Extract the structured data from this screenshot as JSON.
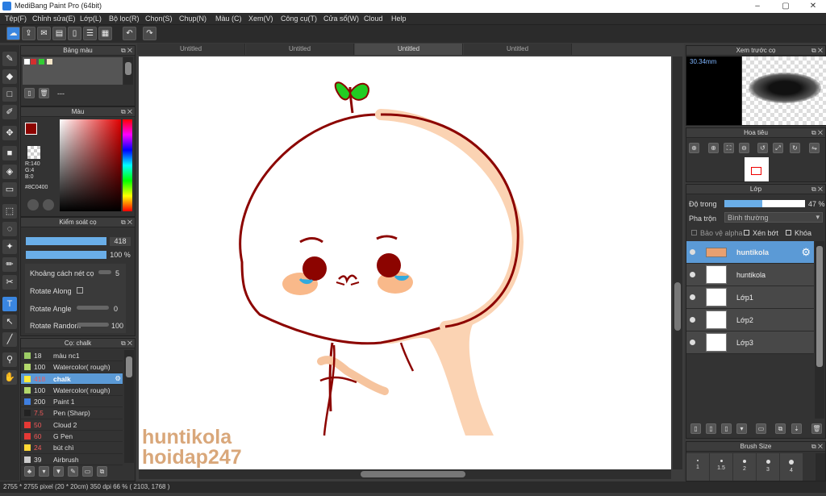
{
  "window": {
    "title": "MediBang Paint Pro (64bit)",
    "min": "–",
    "max": "▢",
    "close": "✕"
  },
  "menu": [
    "Tệp(F)",
    "Chỉnh sửa(E)",
    "Lớp(L)",
    "Bộ lọc(R)",
    "Chọn(S)",
    "Chụp(N)",
    "Màu (C)",
    "Xem(V)",
    "Công cụ(T)",
    "Cửa sổ(W)",
    "Cloud",
    "Help"
  ],
  "tabs": [
    "Untitled",
    "Untitled",
    "Untitled",
    "Untitled"
  ],
  "panels": {
    "palette": {
      "title": "Bảng màu",
      "list_value": "---"
    },
    "color": {
      "title": "Màu",
      "r": "R:140",
      "g": "G:4",
      "b": "B:0",
      "hex": "#8C0400",
      "fg": "#8c0400"
    },
    "brush_control": {
      "title": "Kiểm soát cọ",
      "size": "418",
      "opacity": "100 %",
      "spacing_label": "Khoảng cách nét cọ",
      "spacing_value": "5",
      "rotate_along": "Rotate Along",
      "rotate_angle": "Rotate Angle",
      "rotate_angle_value": "0",
      "rotate_random": "Rotate Random",
      "rotate_random_value": "100"
    },
    "brushes": {
      "title": "Cọ: chalk",
      "items": [
        {
          "n": "18",
          "l": "màu nc1",
          "c": "#9ccc65"
        },
        {
          "n": "100",
          "l": "Watercolor( rough)",
          "c": "#b2d86b"
        },
        {
          "n": "418",
          "l": "chalk",
          "c": "#ffeb3b"
        },
        {
          "n": "100",
          "l": "Watercolor( rough)",
          "c": "#b2d86b"
        },
        {
          "n": "200",
          "l": "Paint 1",
          "c": "#3f7fe0"
        },
        {
          "n": "7.5",
          "l": "Pen (Sharp)",
          "c": "#222222"
        },
        {
          "n": "50",
          "l": "Cloud 2",
          "c": "#e53935"
        },
        {
          "n": "60",
          "l": "G Pen",
          "c": "#e53935"
        },
        {
          "n": "24",
          "l": "bút chì",
          "c": "#fdd835"
        },
        {
          "n": "39",
          "l": "Airbrush",
          "c": "#cccccc"
        }
      ]
    },
    "preview": {
      "title": "Xem trước cọ",
      "size": "30.34mm"
    },
    "navigator": {
      "title": "Hoa tiêu"
    },
    "layer": {
      "title": "Lớp",
      "opacity_label": "Độ trong",
      "opacity": "47 %",
      "opacity_level": 0.47,
      "blend_label": "Pha trộn",
      "blend": "Bình thường",
      "protect_alpha": "Bảo vệ alpha",
      "clip": "Xén bớt",
      "lock": "Khóa",
      "layers": [
        "huntikola",
        "huntikola",
        "Lớp1",
        "Lớp2",
        "Lớp3"
      ]
    },
    "brush_size": {
      "title": "Brush Size",
      "sizes": [
        "1",
        "1.5",
        "2",
        "3",
        "4"
      ]
    }
  },
  "canvas": {
    "watermark1": "huntikola",
    "watermark2": "hoidap247"
  },
  "status": "2755 * 2755 pixel  (20 * 20cm)  350 dpi  66 %  ( 2103, 1768 )"
}
